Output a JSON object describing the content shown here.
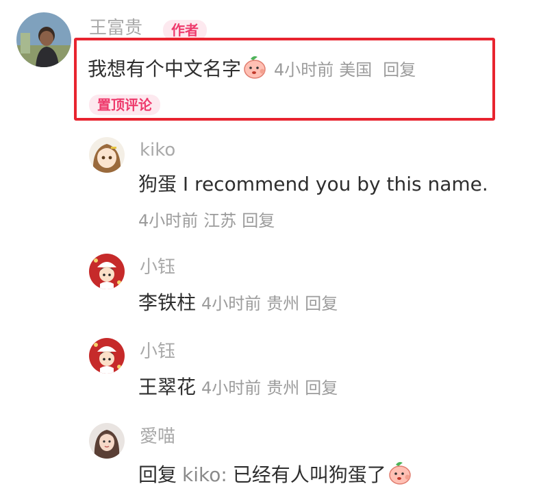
{
  "main_comment": {
    "author": "王富贵",
    "author_badge": "作者",
    "text": "我想有个中文名字",
    "emoji_icon": "peach-face-emoji",
    "time": "4小时前",
    "location": "美国",
    "reply_label": "回复",
    "pinned_label": "置顶评论"
  },
  "replies": [
    {
      "author": "kiko",
      "text": "狗蛋  I recommend you by this name.",
      "time": "4小时前",
      "location": "江苏",
      "reply_label": "回复"
    },
    {
      "author": "小钰",
      "text": "李铁柱",
      "time": "4小时前",
      "location": "贵州",
      "reply_label": "回复"
    },
    {
      "author": "小钰",
      "text": "王翠花",
      "time": "4小时前",
      "location": "贵州",
      "reply_label": "回复"
    },
    {
      "author": "愛喵",
      "reply_prefix": "回复",
      "reply_target": "kiko:",
      "text": "已经有人叫狗蛋了",
      "emoji_icon": "peach-face-emoji"
    }
  ],
  "colors": {
    "highlight_border": "#e8242f",
    "badge_text": "#ee3a6c",
    "badge_bg": "#fde9ef",
    "meta": "#9b9b9b"
  }
}
